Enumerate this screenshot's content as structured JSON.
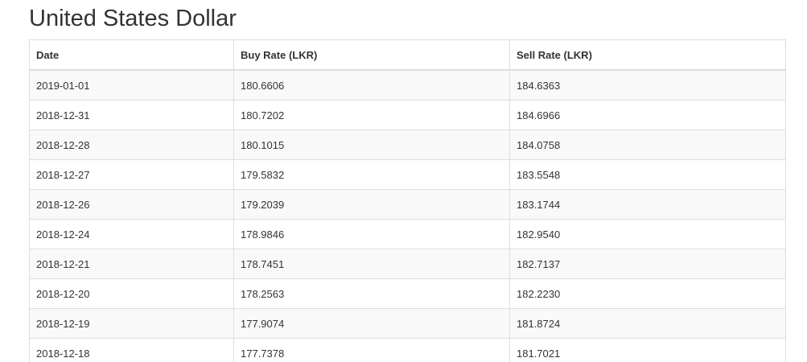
{
  "page": {
    "title": "United States Dollar"
  },
  "table": {
    "headers": {
      "date": "Date",
      "buy": "Buy Rate (LKR)",
      "sell": "Sell Rate (LKR)"
    },
    "rows": [
      {
        "date": "2019-01-01",
        "buy": "180.6606",
        "sell": "184.6363"
      },
      {
        "date": "2018-12-31",
        "buy": "180.7202",
        "sell": "184.6966"
      },
      {
        "date": "2018-12-28",
        "buy": "180.1015",
        "sell": "184.0758"
      },
      {
        "date": "2018-12-27",
        "buy": "179.5832",
        "sell": "183.5548"
      },
      {
        "date": "2018-12-26",
        "buy": "179.2039",
        "sell": "183.1744"
      },
      {
        "date": "2018-12-24",
        "buy": "178.9846",
        "sell": "182.9540"
      },
      {
        "date": "2018-12-21",
        "buy": "178.7451",
        "sell": "182.7137"
      },
      {
        "date": "2018-12-20",
        "buy": "178.2563",
        "sell": "182.2230"
      },
      {
        "date": "2018-12-19",
        "buy": "177.9074",
        "sell": "181.8724"
      },
      {
        "date": "2018-12-18",
        "buy": "177.7378",
        "sell": "181.7021"
      }
    ]
  },
  "colors": {
    "text": "#333333",
    "border": "#dddddd",
    "stripe": "#f9f9f9",
    "background": "#ffffff"
  }
}
